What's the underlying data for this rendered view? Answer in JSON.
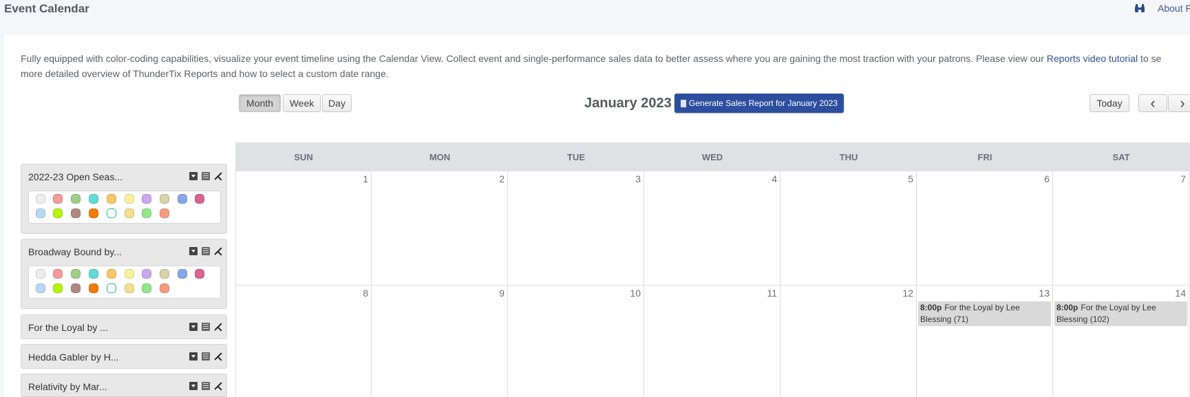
{
  "header": {
    "title": "Event Calendar",
    "about_label": "About F"
  },
  "intro": {
    "line1_pre": "Fully equipped with color-coding capabilities, visualize your event timeline using the Calendar View. Collect event and single-performance sales data to better assess where you are gaining the most traction with your patrons. Please view our ",
    "link_label": "Reports video tutorial",
    "line1_post": " to se",
    "line2": "more detailed overview of ThunderTix Reports and how to select a custom date range."
  },
  "toolbar": {
    "views": [
      "Month",
      "Week",
      "Day"
    ],
    "active_view": "Month",
    "month_title": "January 2023",
    "generate_label": "Generate Sales Report for January 2023",
    "today_label": "Today",
    "prev_label": "‹",
    "next_label": "›"
  },
  "calendar": {
    "days_of_week": [
      "SUN",
      "MON",
      "TUE",
      "WED",
      "THU",
      "FRI",
      "SAT"
    ],
    "weeks": [
      [
        "1",
        "2",
        "3",
        "4",
        "5",
        "6",
        "7"
      ],
      [
        "8",
        "9",
        "10",
        "11",
        "12",
        "13",
        "14"
      ]
    ],
    "events": [
      {
        "day": "13",
        "time": "8:00p",
        "title": "For the Loyal by Lee Blessing (71)"
      },
      {
        "day": "14",
        "time": "8:00p",
        "title": "For the Loyal by Lee Blessing (102)"
      }
    ]
  },
  "sidebar": {
    "items": [
      {
        "label": "2022-23 Open Seas...",
        "expanded": true
      },
      {
        "label": "Broadway Bound by...",
        "expanded": true
      },
      {
        "label": "For the Loyal by ...",
        "expanded": false
      },
      {
        "label": "Hedda Gabler by H...",
        "expanded": false
      },
      {
        "label": "Relativity by Mar...",
        "expanded": false
      }
    ],
    "swatch_colors_row1": [
      "#eeeeee",
      "#f59b9b",
      "#9fcf86",
      "#63d9d9",
      "#f8c76a",
      "#f9f29a",
      "#c9a8f0",
      "#d8d3a8",
      "#86a8ea",
      "#d9648f"
    ],
    "swatch_colors_row2": [
      "#b9d8f7",
      "#b5f50e",
      "#b08a80",
      "#f47a0e",
      "#ffffff",
      "#f1e08e",
      "#92e68c",
      "#f79b80"
    ]
  }
}
